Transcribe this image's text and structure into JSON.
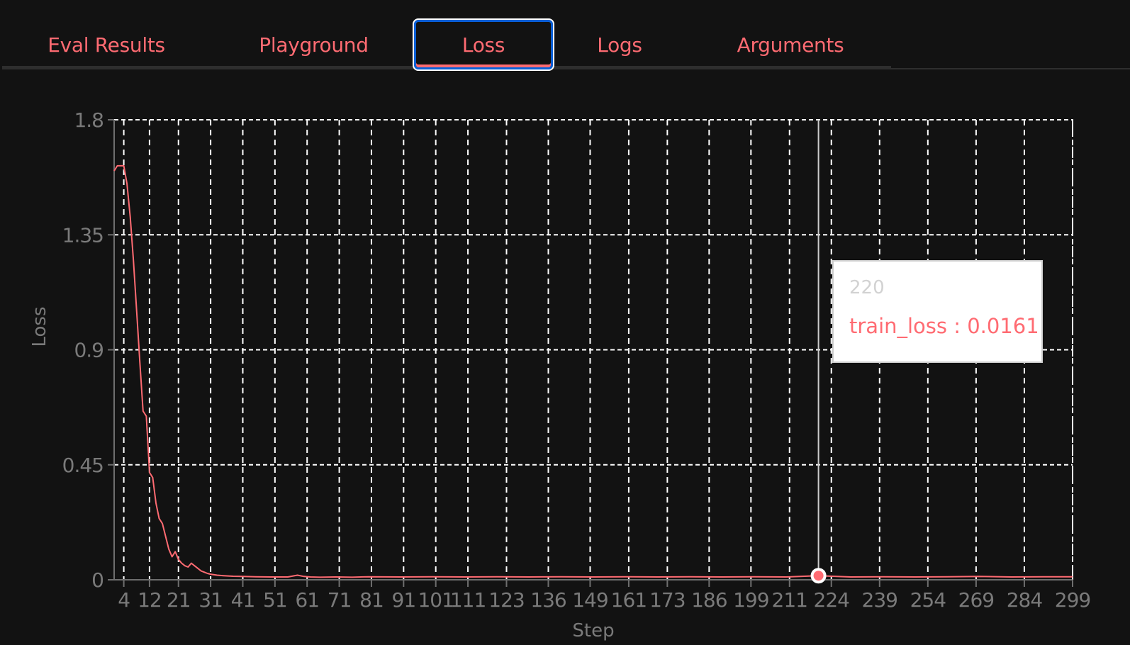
{
  "tabs": [
    {
      "label": "Eval Results",
      "active": false
    },
    {
      "label": "Playground",
      "active": false
    },
    {
      "label": "Loss",
      "active": true
    },
    {
      "label": "Logs",
      "active": false
    },
    {
      "label": "Arguments",
      "active": false
    }
  ],
  "colors": {
    "background": "#121212",
    "accent": "#ff6b72",
    "active_tab_border": "#0a5fd6",
    "grid": "#ffffff",
    "axis_text": "#7a7a7a"
  },
  "tooltip": {
    "title": "220",
    "series_label": "train_loss",
    "separator": " : ",
    "value": "0.0161",
    "text": "train_loss : 0.0161"
  },
  "chart_data": {
    "type": "line",
    "title": "",
    "xlabel": "Step",
    "ylabel": "Loss",
    "ylim": [
      0,
      1.8
    ],
    "xlim": [
      1,
      299
    ],
    "grid": true,
    "legend": "none",
    "yticks": [
      0,
      0.45,
      0.9,
      1.35,
      1.8
    ],
    "ytick_labels": [
      "0",
      "0.45",
      "0.9",
      "1.35",
      "1.8"
    ],
    "xticks": [
      4,
      12,
      21,
      31,
      41,
      51,
      61,
      71,
      81,
      91,
      101,
      111,
      123,
      136,
      149,
      161,
      173,
      186,
      199,
      211,
      224,
      239,
      254,
      269,
      284,
      299
    ],
    "series": [
      {
        "name": "train_loss",
        "color": "#ff6b72",
        "x": [
          1,
          2,
          3,
          4,
          5,
          6,
          7,
          8,
          9,
          10,
          11,
          12,
          13,
          14,
          15,
          16,
          17,
          18,
          19,
          20,
          21,
          22,
          23,
          24,
          25,
          26,
          27,
          28,
          29,
          30,
          31,
          33,
          35,
          38,
          41,
          45,
          50,
          55,
          58,
          60,
          62,
          65,
          70,
          75,
          80,
          90,
          100,
          110,
          120,
          130,
          140,
          150,
          160,
          170,
          180,
          190,
          200,
          210,
          220,
          230,
          240,
          250,
          260,
          270,
          280,
          290,
          299
        ],
        "values": [
          1.6,
          1.62,
          1.62,
          1.62,
          1.55,
          1.42,
          1.25,
          1.05,
          0.85,
          0.66,
          0.64,
          0.42,
          0.4,
          0.3,
          0.24,
          0.22,
          0.17,
          0.12,
          0.09,
          0.11,
          0.08,
          0.065,
          0.055,
          0.05,
          0.065,
          0.055,
          0.045,
          0.035,
          0.03,
          0.025,
          0.022,
          0.018,
          0.016,
          0.014,
          0.013,
          0.012,
          0.011,
          0.011,
          0.018,
          0.013,
          0.011,
          0.01,
          0.011,
          0.01,
          0.012,
          0.011,
          0.012,
          0.011,
          0.012,
          0.011,
          0.012,
          0.011,
          0.012,
          0.011,
          0.012,
          0.011,
          0.012,
          0.011,
          0.0161,
          0.011,
          0.012,
          0.011,
          0.012,
          0.013,
          0.011,
          0.012,
          0.012
        ]
      }
    ],
    "highlight": {
      "x": 220,
      "series": "train_loss",
      "value": 0.0161
    }
  }
}
